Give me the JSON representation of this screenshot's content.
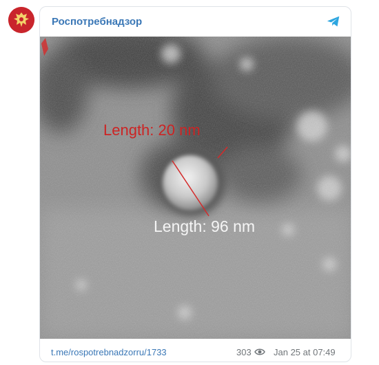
{
  "post": {
    "channel_name": "Роспотребнадзор",
    "channel_icon": "telegram-icon",
    "avatar_icon": "rospotrebnadzor-emblem",
    "image": {
      "label_small": "Length: 20 nm",
      "label_large": "Length: 96 nm"
    },
    "link_text": "t.me/rospotrebnadzorru/1733",
    "views": "303",
    "views_icon": "eye-icon",
    "date": "Jan 25 at 07:49"
  },
  "colors": {
    "link": "#3a77b6",
    "meta": "#707579",
    "telegram": "#2ea6e0",
    "avatar_red": "#c9252c",
    "measure_red": "#d42a2a"
  }
}
